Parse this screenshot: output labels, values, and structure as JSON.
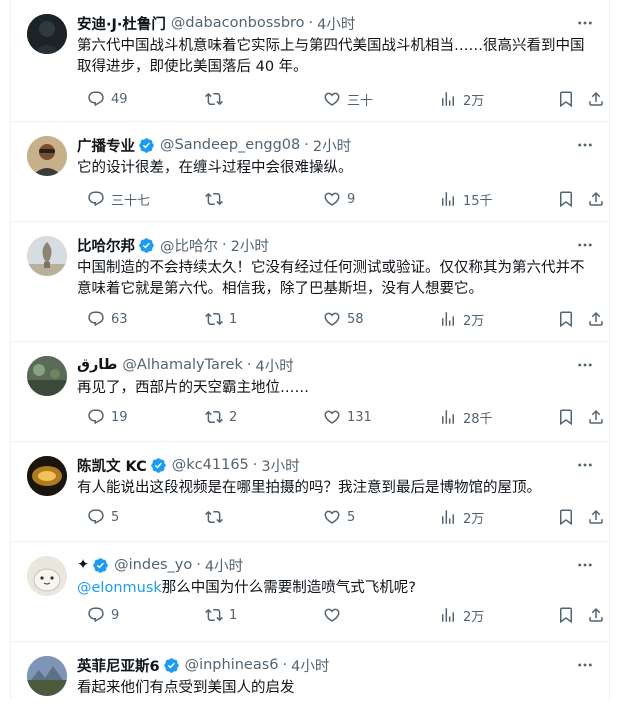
{
  "tweets": [
    {
      "name": "安迪·J·杜鲁门",
      "handle": "@dabaconbossbro",
      "time": "4小时",
      "verified": false,
      "text": "第六代中国战斗机意味着它实际上与第四代美国战斗机相当……很高兴看到中国取得进步，即使比美国落后 40 年。",
      "replies": "49",
      "retweets": "",
      "likes": "三十",
      "views": "2万"
    },
    {
      "name": "广播专业",
      "handle": "@Sandeep_engg08",
      "time": "2小时",
      "verified": true,
      "text": "它的设计很差，在缠斗过程中会很难操纵。",
      "replies": "三十七",
      "retweets": "",
      "likes": "9",
      "views": "15千"
    },
    {
      "name": "比哈尔邦",
      "handle": "@比哈尔",
      "time": "2小时",
      "verified": true,
      "text": "中国制造的不会持续太久！它没有经过任何测试或验证。仅仅称其为第六代并不意味着它就是第六代。相信我，除了巴基斯坦，没有人想要它。",
      "replies": "63",
      "retweets": "1",
      "likes": "58",
      "views": "2万"
    },
    {
      "name": "طارق",
      "handle": "@AlhamalyTarek",
      "time": "4小时",
      "verified": false,
      "text": "再见了，西部片的天空霸主地位……",
      "replies": "19",
      "retweets": "2",
      "likes": "131",
      "views": "28千"
    },
    {
      "name": "陈凯文 KC",
      "handle": "@kc41165",
      "time": "3小时",
      "verified": true,
      "text": "有人能说出这段视频是在哪里拍摄的吗？我注意到最后是博物馆的屋顶。",
      "replies": "5",
      "retweets": "",
      "likes": "5",
      "views": "2万"
    },
    {
      "name": "✦",
      "handle": "@indes_yo",
      "time": "4小时",
      "verified": true,
      "mention": "@elonmusk",
      "text": "那么中国为什么需要制造喷气式飞机呢?",
      "replies": "9",
      "retweets": "1",
      "likes": "",
      "views": "2万"
    },
    {
      "name": "英菲尼亚斯6",
      "handle": "@inphineas6",
      "time": "4小时",
      "verified": true,
      "text": "看起来他们有点受到美国人的启发"
    }
  ],
  "separator": "·",
  "colors": {
    "accent": "#1d9bf0",
    "text": "#0f1419",
    "muted": "#536471",
    "border": "#eff3f4"
  }
}
